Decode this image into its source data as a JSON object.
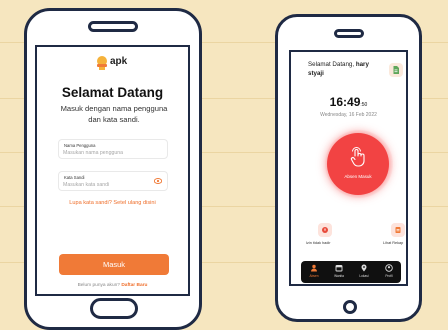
{
  "colors": {
    "background": "#f6e6bf",
    "frame": "#1f2a44",
    "accent": "#f07a37",
    "absen_red": "#f24343"
  },
  "login": {
    "logo_text": "apk",
    "logo_subtext": "",
    "title": "Selamat Datang",
    "subtitle": "Masuk dengan nama pengguna dan kata sandi.",
    "username_label": "Nama Pengguna",
    "username_placeholder": "Masukan nama pengguna",
    "password_label": "Kata Sandi",
    "password_placeholder": "Masukan kata sandi",
    "forgot_link": "Lupa kata sandi? Setel ulang disini",
    "login_button": "Masuk",
    "register_prompt": "Belum punya akun?",
    "register_link": "Daftar Baru"
  },
  "home": {
    "greeting_prefix": "Selamat Datang,",
    "user_name": "hary styaji",
    "time_main": "16:49",
    "time_seconds": ":50",
    "date": "Wednesday, 16 Feb 2022",
    "absen_label": "Absen Masuk",
    "quick_left_label": "Izin tidak hadir",
    "quick_right_label": "Lihat Rekap",
    "nav": [
      {
        "label": "Absen",
        "icon": "user-icon",
        "active": true
      },
      {
        "label": "Wanita",
        "icon": "calendar-icon",
        "active": false
      },
      {
        "label": "Lokasi",
        "icon": "location-icon",
        "active": false
      },
      {
        "label": "Profil",
        "icon": "profile-icon",
        "active": false
      }
    ]
  }
}
